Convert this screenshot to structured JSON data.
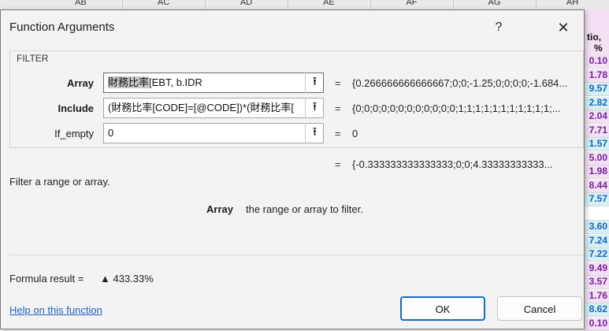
{
  "spreadsheet": {
    "column_headers": [
      "AB",
      "AC",
      "AD",
      "AE",
      "AF",
      "AG",
      "AH"
    ],
    "right_column": {
      "header_line1": "tio,",
      "header_line2": "%",
      "cells": [
        {
          "text": "0.10",
          "color": "#7a1fa2",
          "bg": "#f3e1f3"
        },
        {
          "text": "1.78",
          "color": "#7a1fa2",
          "bg": "#f3e1f3"
        },
        {
          "text": "9.57",
          "color": "#1565c0",
          "bg": "#d6f0f6"
        },
        {
          "text": "2.82",
          "color": "#1565c0",
          "bg": "#d6f0f6"
        },
        {
          "text": "2.04",
          "color": "#7a1fa2",
          "bg": "#f3e1f3"
        },
        {
          "text": "7.71",
          "color": "#7a1fa2",
          "bg": "#f3e1f3"
        },
        {
          "text": "1.57",
          "color": "#1565c0",
          "bg": "#d6f0f6"
        },
        {
          "text": "5.00",
          "color": "#7a1fa2",
          "bg": "#f3e1f3"
        },
        {
          "text": "1.98",
          "color": "#7a1fa2",
          "bg": "#f3e1f3"
        },
        {
          "text": "8.44",
          "color": "#7a1fa2",
          "bg": "#f3e1f3"
        },
        {
          "text": "7.57",
          "color": "#1565c0",
          "bg": "#d6f0f6"
        },
        {
          "text": "",
          "color": "#7a1fa2",
          "bg": "#ffffff"
        },
        {
          "text": "3.60",
          "color": "#1565c0",
          "bg": "#d6f0f6"
        },
        {
          "text": "7.24",
          "color": "#1565c0",
          "bg": "#d6f0f6"
        },
        {
          "text": "7.22",
          "color": "#1565c0",
          "bg": "#d6f0f6"
        },
        {
          "text": "9.49",
          "color": "#7a1fa2",
          "bg": "#f3e1f3"
        },
        {
          "text": "3.57",
          "color": "#7a1fa2",
          "bg": "#f3e1f3"
        },
        {
          "text": "1.76",
          "color": "#7a1fa2",
          "bg": "#f3e1f3"
        },
        {
          "text": "8.62",
          "color": "#1565c0",
          "bg": "#d6f0f6"
        },
        {
          "text": "0.10",
          "color": "#7a1fa2",
          "bg": "#f3e1f3"
        }
      ]
    }
  },
  "dialog": {
    "title": "Function Arguments",
    "help_symbol": "?",
    "close_symbol": "✕",
    "function_name": "FILTER",
    "arguments": [
      {
        "label": "Array",
        "value_highlight": "財務比率",
        "value_rest": "[EBT, b.IDR",
        "result": "{0.266666666666667;0;0;-1.25;0;0;0;0;-1.684...",
        "bold": true
      },
      {
        "label": "Include",
        "value_highlight": "",
        "value_rest": "(財務比率[CODE]=[@CODE])*(財務比率[",
        "result": "{0;0;0;0;0;0;0;0;0;0;0;0;1;1;1;1;1;1;1;1;1;1;1;...",
        "bold": true
      },
      {
        "label": "If_empty",
        "value_highlight": "",
        "value_rest": "0",
        "result": "0",
        "bold": false
      }
    ],
    "equals": "=",
    "collapse_icon": "⭱",
    "overall_result": "{-0.333333333333333;0;0;4.33333333333...",
    "description": "Filter a range or array.",
    "arg_help_name": "Array",
    "arg_help_text": "the range or array to filter.",
    "formula_result_label": "Formula result =",
    "formula_result_value": "▲ 433.33%",
    "help_link": "Help on this function",
    "ok_label": "OK",
    "cancel_label": "Cancel"
  }
}
